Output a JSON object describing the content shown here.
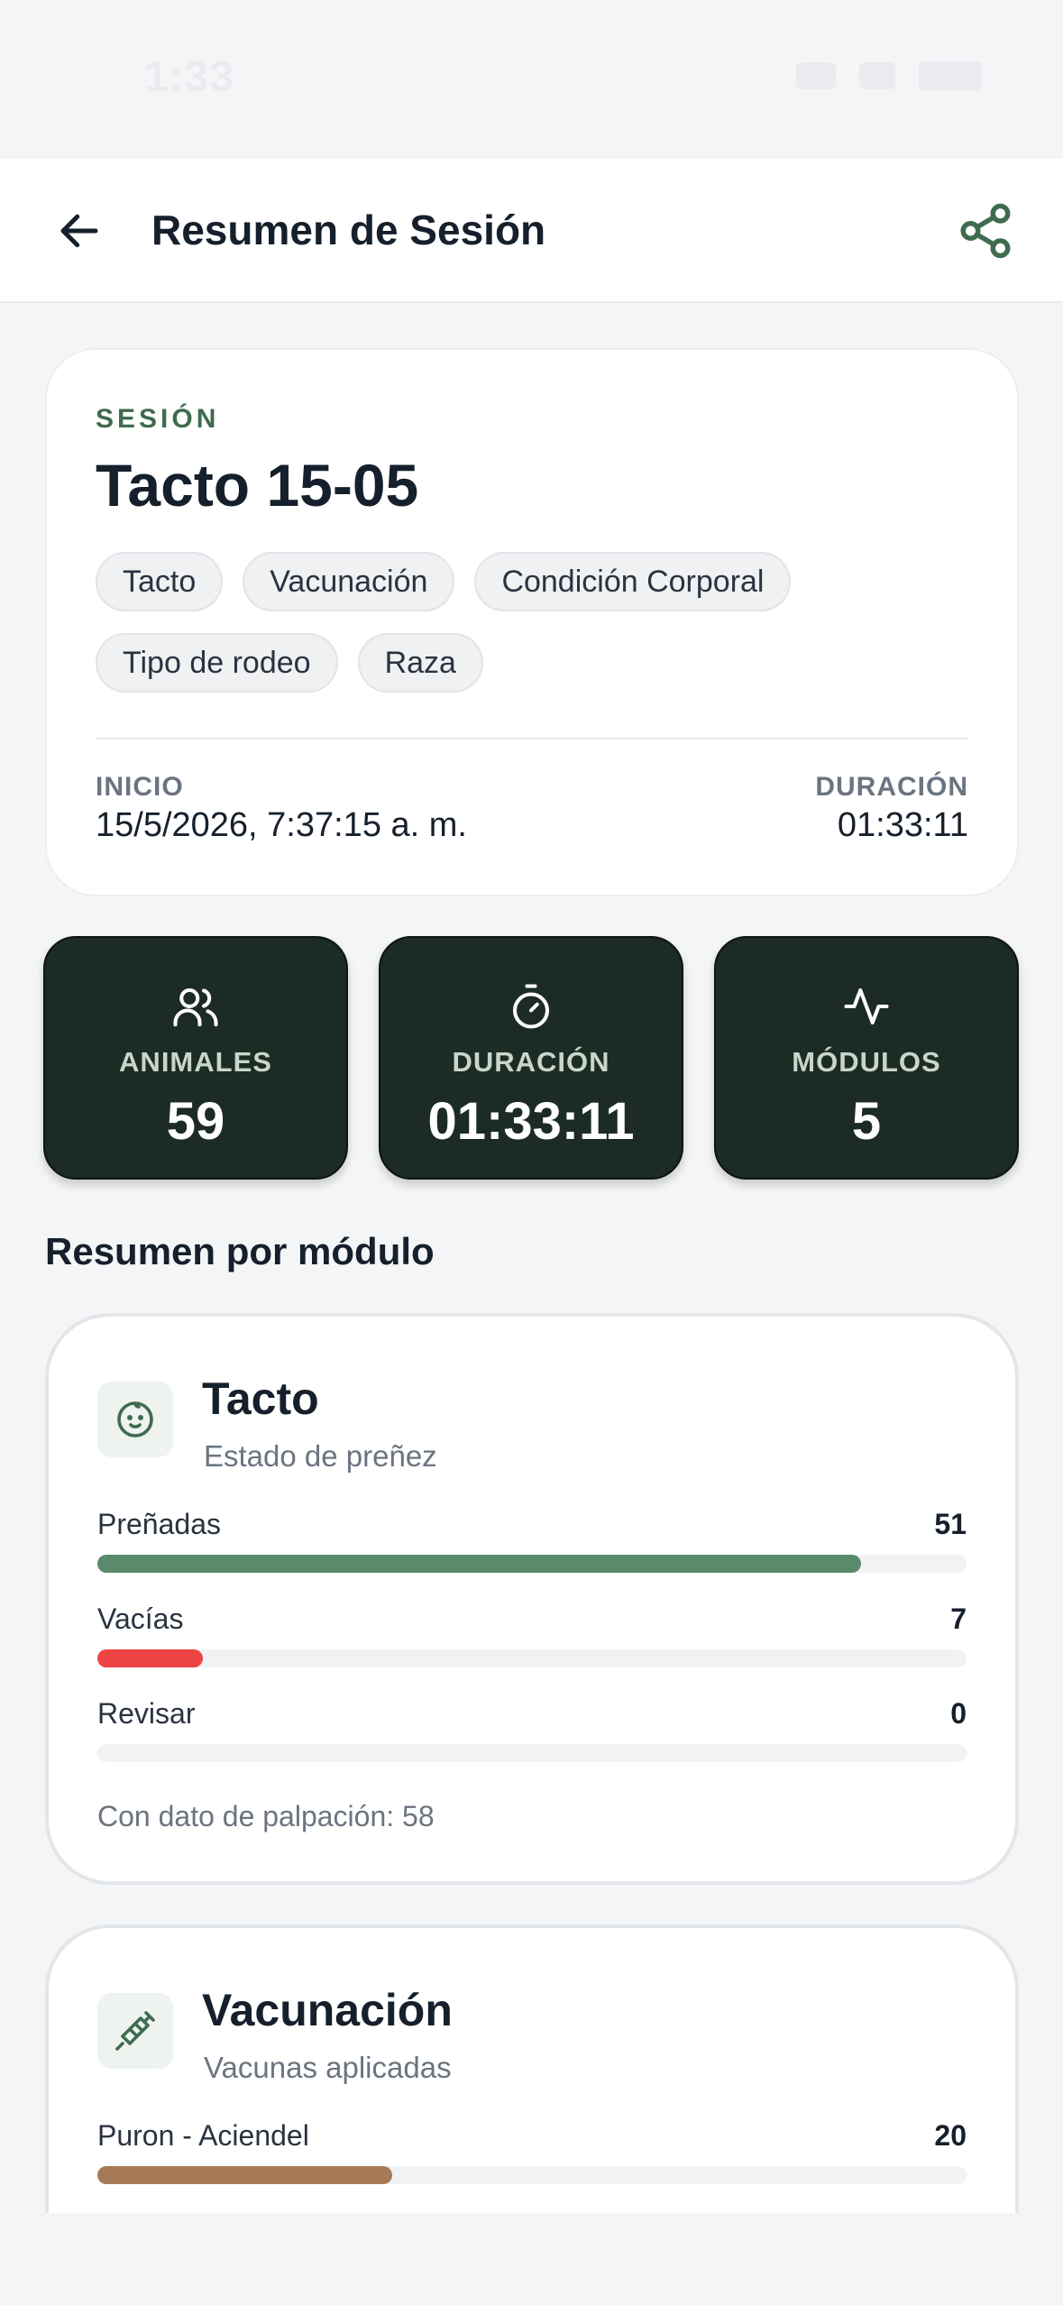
{
  "status_bar": {
    "time": "1:33"
  },
  "header": {
    "title": "Resumen de Sesión"
  },
  "session": {
    "eyebrow": "SESIÓN",
    "name": "Tacto 15-05",
    "tags": [
      "Tacto",
      "Vacunación",
      "Condición Corporal",
      "Tipo de rodeo",
      "Raza"
    ],
    "start_label": "INICIO",
    "start_value": "15/5/2026, 7:37:15 a. m.",
    "duration_label": "DURACIÓN",
    "duration_value": "01:33:11"
  },
  "stats": [
    {
      "label": "ANIMALES",
      "value": "59",
      "icon": "users-icon"
    },
    {
      "label": "DURACIÓN",
      "value": "01:33:11",
      "icon": "timer-icon"
    },
    {
      "label": "MÓDULOS",
      "value": "5",
      "icon": "activity-icon"
    }
  ],
  "section_title": "Resumen por módulo",
  "modules": [
    {
      "title": "Tacto",
      "subtitle": "Estado de preñez",
      "icon": "baby-face-icon",
      "rows": [
        {
          "label": "Preñadas",
          "value": "51",
          "fraction": 0.879,
          "color": "#5a8a6c"
        },
        {
          "label": "Vacías",
          "value": "7",
          "fraction": 0.121,
          "color": "#ef4444"
        },
        {
          "label": "Revisar",
          "value": "0",
          "fraction": 0,
          "color": "#9aa3ad"
        }
      ],
      "footer": "Con dato de palpación: 58"
    },
    {
      "title": "Vacunación",
      "subtitle": "Vacunas aplicadas",
      "icon": "syringe-icon",
      "rows": [
        {
          "label": "Puron - Aciendel",
          "value": "20",
          "fraction": 0.339,
          "color": "#a67a56"
        }
      ]
    }
  ],
  "colors": {
    "accent": "#3f6b4f",
    "stat_bg": "#1c2b23"
  }
}
